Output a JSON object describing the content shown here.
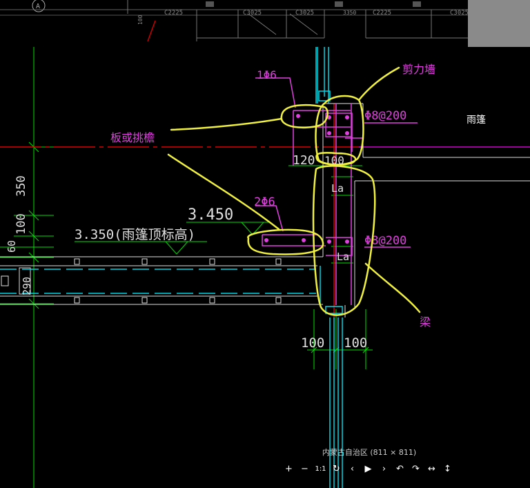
{
  "top_strip": {
    "axis_label": "A",
    "labels": [
      "C2225",
      "C3025",
      "C3025",
      "3350",
      "C2225",
      "C3025",
      "100"
    ]
  },
  "drawing": {
    "dims_left": [
      "350",
      "100",
      "60",
      "290"
    ],
    "elev_upper": "3.450",
    "elev_lower": "3.350(雨篷顶标高)",
    "rebar_top": "1Φ6",
    "rebar_mid": "2Φ6",
    "stirrup_upper": "Φ8@200",
    "stirrup_lower": "Φ8@200",
    "dim_120": "120",
    "dim_100_small": "100",
    "la_upper": "La",
    "la_lower": "La",
    "dim_bottom_left": "100",
    "dim_bottom_right": "100",
    "room_label": "雨篷"
  },
  "annotations": {
    "shear_wall": "剪力墙",
    "slab": "板或挑檐",
    "beam": "梁"
  },
  "viewer": {
    "caption": "内蒙古自治区 (811 × 811)",
    "buttons": [
      "+",
      "−",
      "1:1",
      "↻",
      "‹",
      "▶",
      "›",
      "↶",
      "↷",
      "↔",
      "↕"
    ]
  }
}
